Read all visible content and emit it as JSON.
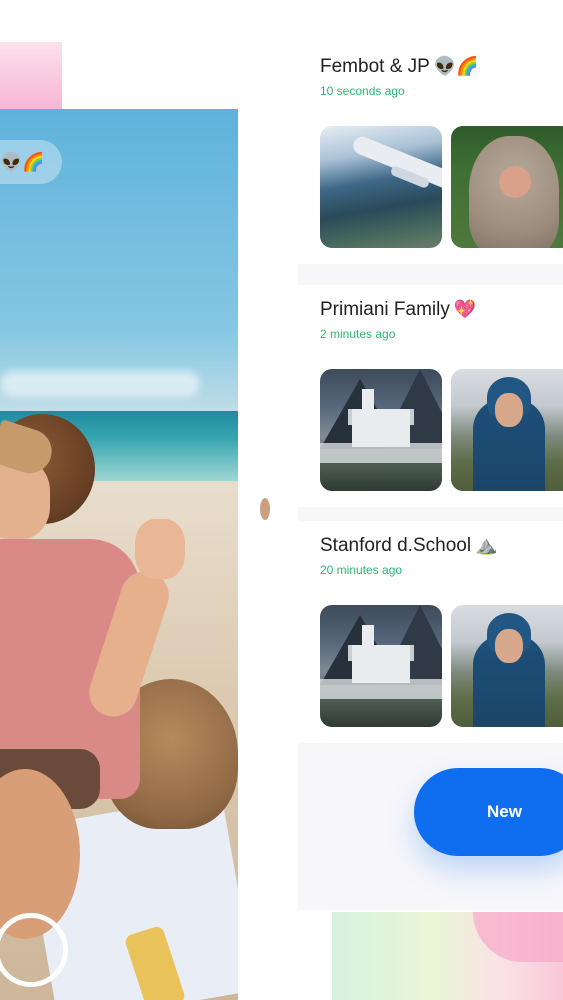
{
  "story": {
    "emoji": "👽🌈"
  },
  "feed": {
    "cards": [
      {
        "title": "Fembot & JP",
        "emoji": "👽🌈",
        "time": "10 seconds ago"
      },
      {
        "title": "Primiani Family",
        "emoji": "💖",
        "time": "2 minutes ago"
      },
      {
        "title": "Stanford d.School",
        "emoji": "⛰️",
        "time": "20 minutes ago"
      }
    ]
  },
  "new_button": {
    "label": "New"
  },
  "colors": {
    "accent": "#0f6ef0",
    "timestamp": "#2bb673",
    "title": "#222222"
  }
}
